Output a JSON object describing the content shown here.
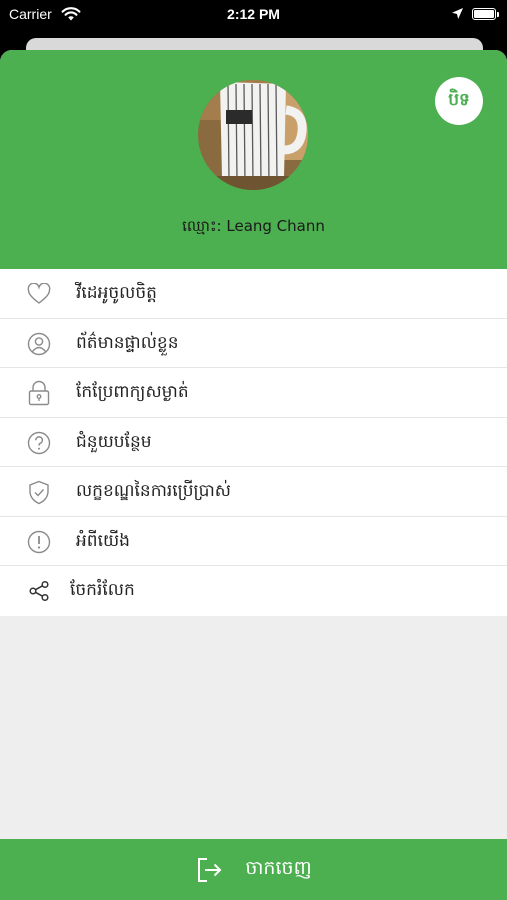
{
  "status_bar": {
    "carrier": "Carrier",
    "time": "2:12 PM"
  },
  "profile": {
    "name_label": "ឈ្មោះ: Leang Chann",
    "close_label": "បិទ"
  },
  "menu": {
    "items": [
      {
        "label": "វីដេអូចូលចិត្ត",
        "icon": "heart-icon"
      },
      {
        "label": "ព័ត៌មានផ្ទាល់ខ្លួន",
        "icon": "user-icon"
      },
      {
        "label": "កែប្រែពាក្យសម្ងាត់",
        "icon": "lock-icon"
      },
      {
        "label": "ជំនួយបន្ថែម",
        "icon": "help-icon"
      },
      {
        "label": "លក្ខខណ្ឌនៃការប្រើប្រាស់",
        "icon": "shield-check-icon"
      },
      {
        "label": "អំពីយើង",
        "icon": "info-icon"
      },
      {
        "label": "ចែករំលែក",
        "icon": "share-icon"
      }
    ]
  },
  "logout": {
    "label": "ចាកចេញ",
    "icon": "logout-icon"
  },
  "colors": {
    "primary": "#4caf50",
    "menu_bg": "#ffffff",
    "page_bg": "#eeeeee"
  }
}
